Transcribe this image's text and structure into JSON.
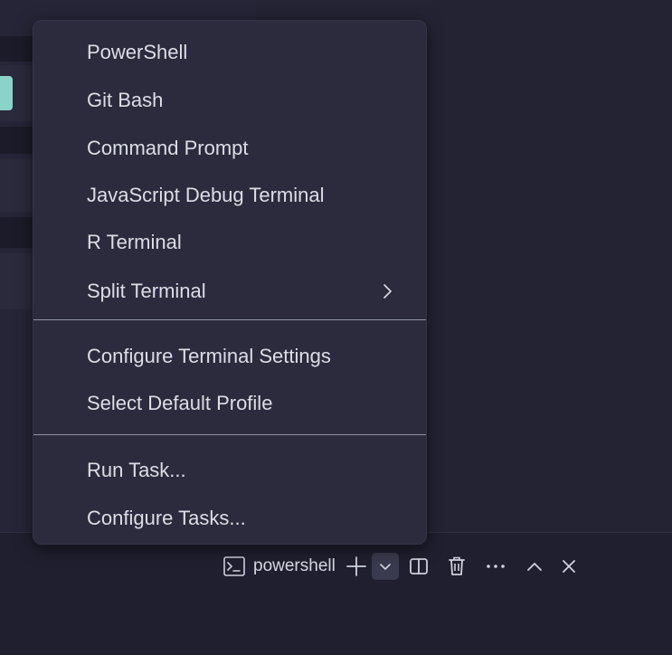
{
  "menu": {
    "items": [
      {
        "label": "PowerShell"
      },
      {
        "label": "Git Bash"
      },
      {
        "label": "Command Prompt"
      },
      {
        "label": "JavaScript Debug Terminal"
      },
      {
        "label": "R Terminal"
      },
      {
        "label": "Split Terminal",
        "submenu": true
      }
    ],
    "settings_items": [
      {
        "label": "Configure Terminal Settings"
      },
      {
        "label": "Select Default Profile"
      }
    ],
    "task_items": [
      {
        "label": "Run Task..."
      },
      {
        "label": "Configure Tasks..."
      }
    ]
  },
  "toolbar": {
    "terminal_tab_label": "powershell",
    "icons": [
      "terminal-icon",
      "plus-icon",
      "chevron-down-icon",
      "split-icon",
      "trash-icon",
      "more-icon",
      "chevron-up-icon",
      "close-icon"
    ]
  },
  "colors": {
    "menu_bg": "#2b2b3d",
    "menu_text": "#dcdee6",
    "separator": "#8f93a4",
    "accent": "#8ad3c8",
    "background": "#1e1e2e"
  }
}
